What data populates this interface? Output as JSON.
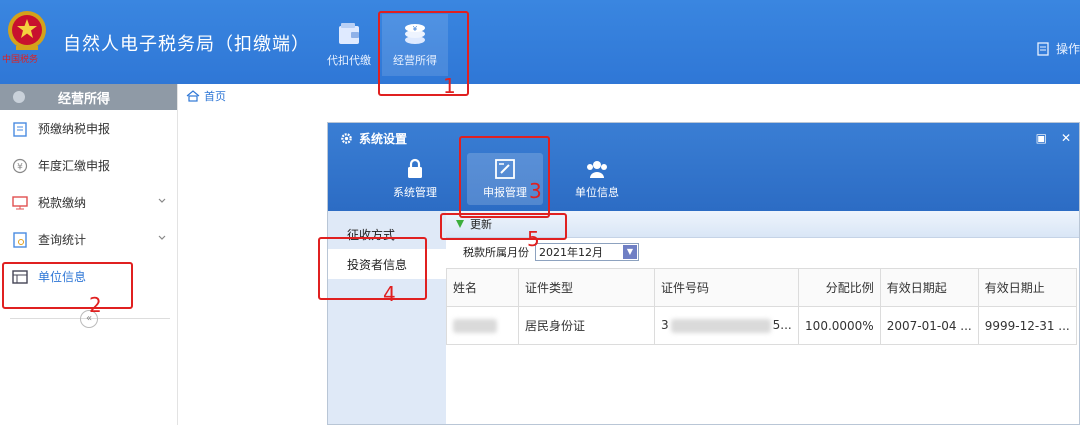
{
  "header": {
    "app_title": "自然人电子税务局（扣缴端）",
    "emblem_caption": "中国税务",
    "top_buttons": [
      {
        "label": "代扣代缴",
        "icon": "wallet-icon"
      },
      {
        "label": "经营所得",
        "icon": "coins-icon"
      }
    ],
    "right_label": "操作"
  },
  "sidebar": {
    "title": "经营所得",
    "items": [
      {
        "label": "预缴纳税申报",
        "icon": "clipboard-icon"
      },
      {
        "label": "年度汇缴申报",
        "icon": "yen-icon"
      },
      {
        "label": "税款缴纳",
        "icon": "monitor-icon"
      },
      {
        "label": "查询统计",
        "icon": "report-icon"
      },
      {
        "label": "单位信息",
        "icon": "table-icon"
      }
    ],
    "collapse_label": "«"
  },
  "breadcrumb": {
    "home": "首页"
  },
  "dialog": {
    "title": "系统设置",
    "tabs": [
      {
        "label": "系统管理",
        "icon": "lock-icon"
      },
      {
        "label": "申报管理",
        "icon": "edit-icon"
      },
      {
        "label": "单位信息",
        "icon": "group-icon"
      }
    ],
    "left_nav": [
      "征收方式",
      "投资者信息"
    ],
    "toolbar": {
      "update_label": "更新"
    },
    "filter": {
      "label": "税款所属月份",
      "value": "2021年12月"
    },
    "table": {
      "headers": [
        "姓名",
        "证件类型",
        "证件号码",
        "分配比例",
        "有效日期起",
        "有效日期止"
      ],
      "rows": [
        [
          "",
          "居民身份证",
          "3",
          "100.0000%",
          "2007-01-04 ...",
          "9999-12-31 ..."
        ]
      ],
      "id_suffix": "5..."
    }
  },
  "annotations": [
    "1",
    "2",
    "3",
    "4",
    "5"
  ],
  "colors": {
    "header_blue": "#2f77d6",
    "annotation_red": "#e02020"
  }
}
